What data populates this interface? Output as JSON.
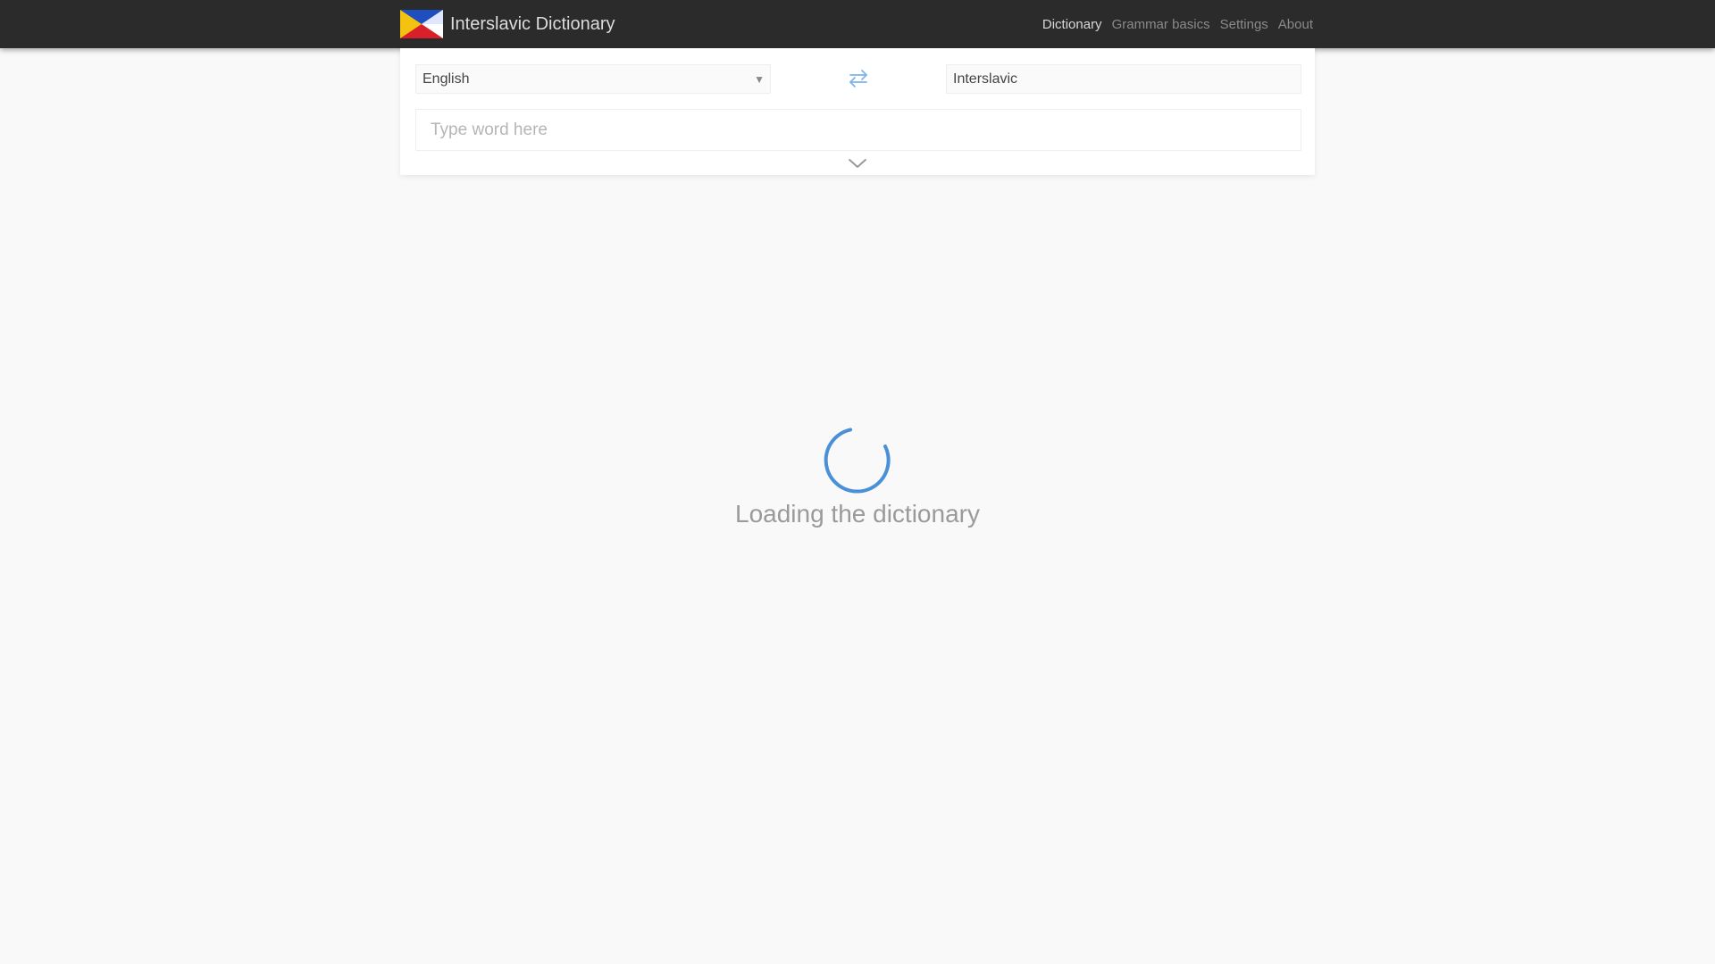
{
  "header": {
    "title": "Interslavic Dictionary",
    "logo_icon": "interslavic-flag-icon",
    "nav": [
      {
        "label": "Dictionary",
        "active": true
      },
      {
        "label": "Grammar basics",
        "active": false
      },
      {
        "label": "Settings",
        "active": false
      },
      {
        "label": "About",
        "active": false
      }
    ]
  },
  "search": {
    "from_lang": "English",
    "to_lang": "Interslavic",
    "placeholder": "Type word here",
    "value": "",
    "swap_icon": "swap-arrows-icon",
    "expand_icon": "chevron-down-icon"
  },
  "loader": {
    "text": "Loading the dictionary",
    "spinner_icon": "loading-spinner-icon"
  },
  "colors": {
    "header_bg": "#2b2b2b",
    "accent": "#4a90d9",
    "page_bg": "#f9f9f9"
  }
}
